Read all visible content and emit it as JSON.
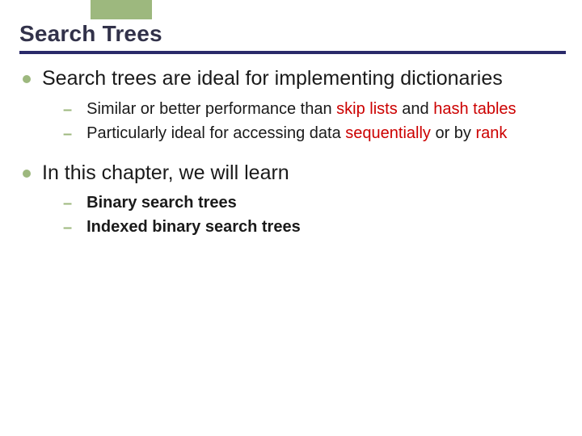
{
  "title": "Search Trees",
  "bullets": [
    {
      "text": "Search trees are ideal for implementing dictionaries",
      "sub": [
        {
          "pre": "Similar or better performance than ",
          "em1": "skip lists",
          "mid": " and ",
          "em2": "hash tables",
          "post": ""
        },
        {
          "pre": "Particularly ideal for accessing data ",
          "em1": "sequentially",
          "mid": " or by ",
          "em2": "rank",
          "post": ""
        }
      ]
    },
    {
      "text": "In this chapter, we will learn",
      "sub": [
        {
          "bold": "Binary search trees"
        },
        {
          "bold": "Indexed binary search trees"
        }
      ]
    }
  ]
}
